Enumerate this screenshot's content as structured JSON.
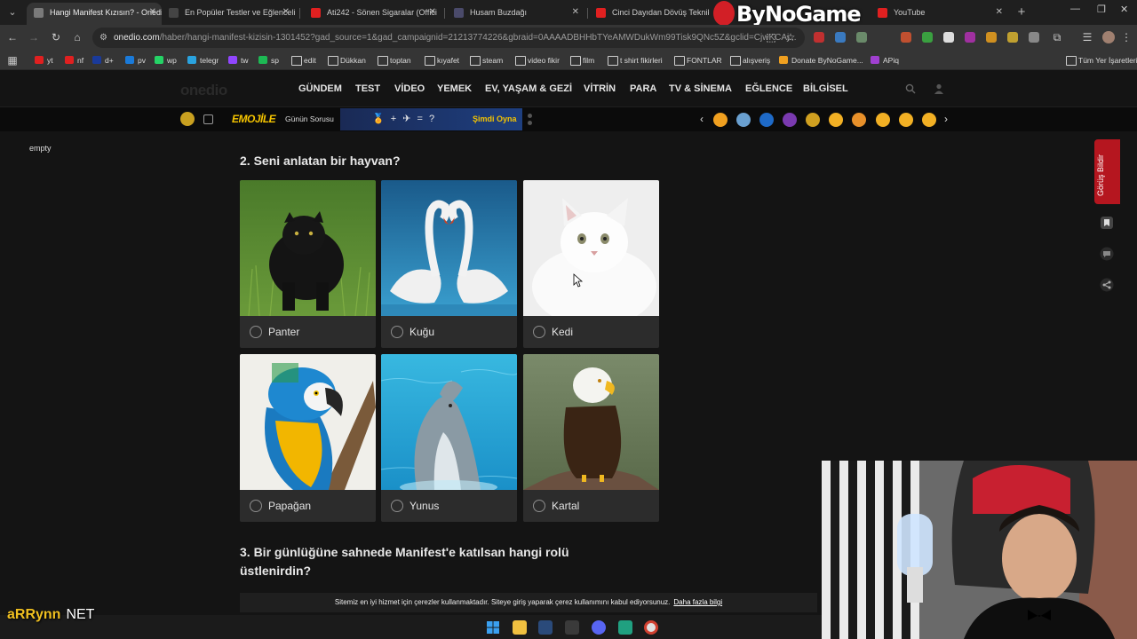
{
  "browser": {
    "tabs": [
      {
        "title": "Hangi Manifest Kızısın? - Onedio",
        "active": true,
        "favicon": "#7a7a7a"
      },
      {
        "title": "En Popüler Testler ve Eğlenceli",
        "active": false,
        "favicon": "#444"
      },
      {
        "title": "Ati242 - Sönen Sigaralar (Offici",
        "active": false,
        "favicon": "#e02020"
      },
      {
        "title": "Husam Buzdağı",
        "active": false,
        "favicon": "#4a4a6a"
      },
      {
        "title": "Cinci Dayıdan Dövüş Teknikleri",
        "active": false,
        "favicon": "#e02020"
      },
      {
        "title": "YouTube",
        "active": false,
        "favicon": "#e02020"
      }
    ],
    "new_tab": "+",
    "window_controls": [
      "—",
      "❐",
      "✕"
    ],
    "url_host": "onedio.com",
    "url_path": "/haber/hangi-manifest-kizisin-1301452?gad_source=1&gad_campaignid=21213774226&gbraid=0AAAADBHHbTYeAMWDukWm99Tisk9QNc5Z&gclid=CjwKCAj...",
    "bookmarks": [
      {
        "label": "yt",
        "color": "#e02020",
        "folder": false
      },
      {
        "label": "nf",
        "color": "#e02020",
        "folder": false
      },
      {
        "label": "d+",
        "color": "#1a3a9a",
        "folder": false
      },
      {
        "label": "pv",
        "color": "#1a7ad9",
        "folder": false
      },
      {
        "label": "wp",
        "color": "#25d366",
        "folder": false
      },
      {
        "label": "telegr",
        "color": "#2aa3df",
        "folder": false
      },
      {
        "label": "tw",
        "color": "#9146ff",
        "folder": false
      },
      {
        "label": "sp",
        "color": "#1db954",
        "folder": false
      },
      {
        "label": "edit",
        "color": "#888",
        "folder": true
      },
      {
        "label": "Dükkan",
        "color": "#888",
        "folder": true
      },
      {
        "label": "toptan",
        "color": "#888",
        "folder": true
      },
      {
        "label": "kıyafet",
        "color": "#888",
        "folder": true
      },
      {
        "label": "steam",
        "color": "#888",
        "folder": true
      },
      {
        "label": "video fikir",
        "color": "#888",
        "folder": true
      },
      {
        "label": "film",
        "color": "#888",
        "folder": true
      },
      {
        "label": "t shirt fikirleri",
        "color": "#888",
        "folder": true
      },
      {
        "label": "FONTLAR",
        "color": "#888",
        "folder": true
      },
      {
        "label": "alışveriş",
        "color": "#888",
        "folder": true
      },
      {
        "label": "Donate ByNoGame...",
        "color": "#f0a020",
        "folder": false
      },
      {
        "label": "APiq",
        "color": "#a040d0",
        "folder": false
      }
    ],
    "all_bookmarks": "Tüm Yer İşaretleri"
  },
  "watermark": "ByNoGame",
  "site": {
    "logo": "onedio",
    "nav": [
      "GÜNDEM",
      "TEST",
      "VİDEO",
      "YEMEK",
      "EV, YAŞAM & GEZİ",
      "VİTRİN",
      "PARA",
      "TV & SİNEMA",
      "EĞLENCE",
      "BİLGİSEL"
    ]
  },
  "strip": {
    "brand": "EMOJİLE",
    "daily_question": "Günün Sorusu",
    "puzzle": "🏅 + ✈ = ?",
    "play_now": "Şimdi Oyna",
    "emojis": [
      "#f0a020",
      "#6aa0d0",
      "#1e6ac8",
      "#7a3ab0",
      "#d0a020",
      "#f2b024",
      "#e8902a",
      "#f2b024",
      "#f2b024",
      "#f2b024"
    ]
  },
  "main": {
    "sidebar_label": "empty",
    "question2": "2. Seni anlatan bir hayvan?",
    "options": [
      {
        "label": "Panter"
      },
      {
        "label": "Kuğu"
      },
      {
        "label": "Kedi"
      },
      {
        "label": "Papağan"
      },
      {
        "label": "Yunus"
      },
      {
        "label": "Kartal"
      }
    ],
    "question3": "3. Bir günlüğüne sahnede Manifest'e katılsan hangi rolü üstlenirdin?"
  },
  "feedback": "Görüş Bildir",
  "cookie": {
    "text": "Sitemiz en iyi hizmet için çerezler kullanmaktadır. Siteye giriş yaparak çerez kullanımını kabul ediyorsunuz.",
    "link": "Daha fazla bilgi"
  },
  "streamer": {
    "name": "aRRynn",
    "suffix": "NET"
  }
}
